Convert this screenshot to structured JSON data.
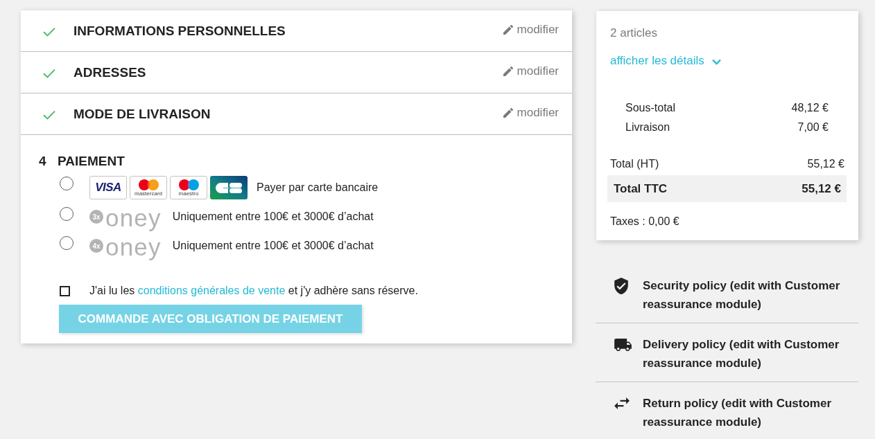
{
  "checkout_steps": [
    {
      "title": "INFORMATIONS PERSONNELLES",
      "complete": true,
      "edit_link": "modifier"
    },
    {
      "title": "ADRESSES",
      "complete": true,
      "edit_link": "modifier"
    },
    {
      "title": "MODE DE LIVRAISON",
      "complete": true,
      "edit_link": "modifier"
    },
    {
      "number": "4",
      "title": "PAIEMENT",
      "complete": false,
      "payment_options": [
        {
          "kind": "cards",
          "selected": false,
          "logos": [
            {
              "kind": "visa",
              "text": "VISA"
            },
            {
              "kind": "mastercard",
              "caption": "mastercard"
            },
            {
              "kind": "maestro",
              "caption": "maestro"
            },
            {
              "kind": "cb"
            }
          ],
          "label": "Payer par carte bancaire"
        },
        {
          "kind": "oney",
          "selected": false,
          "badge": "3x",
          "brand": "oney",
          "label": "Uniquement entre 100€ et 3000€ d’achat"
        },
        {
          "kind": "oney",
          "selected": false,
          "badge": "4x",
          "brand": "oney",
          "label": "Uniquement entre 100€ et 3000€ d’achat"
        }
      ],
      "terms": {
        "checked": false,
        "before": "J'ai lu les",
        "link": "conditions générales de vente",
        "after": "et j'y adhère sans réserve."
      },
      "submit_button": {
        "label": "COMMANDE AVEC OBLIGATION DE PAIEMENT",
        "disabled": true
      }
    }
  ],
  "cart_summary": {
    "items_count": "2 articles",
    "details_link": "afficher les détails",
    "details_expanded": false,
    "subtotals": [
      {
        "label": "Sous-total",
        "value": "48,12 €"
      },
      {
        "label": "Livraison",
        "value": "7,00 €"
      }
    ],
    "totals": [
      {
        "kind": "net",
        "label": "Total (HT)",
        "value": "55,12 €"
      },
      {
        "kind": "gross",
        "label": "Total TTC",
        "value": "55,12 €"
      }
    ],
    "taxes": "Taxes : 0,00 €"
  },
  "reassurance": [
    {
      "kind": "security",
      "text": "Security policy (edit with Customer reassurance module)"
    },
    {
      "kind": "delivery",
      "text": "Delivery policy (edit with Customer reassurance module)"
    },
    {
      "kind": "returns",
      "text": "Return policy (edit with Customer reassurance module)"
    }
  ]
}
